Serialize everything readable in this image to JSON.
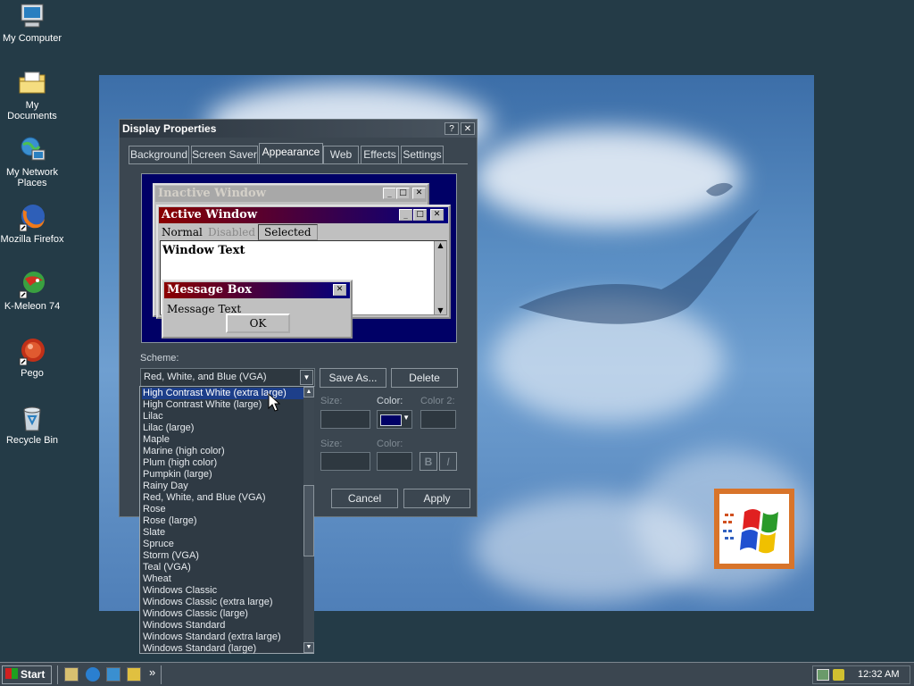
{
  "desktop": {
    "icons": [
      {
        "label": "My Computer",
        "icon": "computer-icon"
      },
      {
        "label": "My Documents",
        "icon": "folder-icon"
      },
      {
        "label": "My Network Places",
        "icon": "network-icon"
      },
      {
        "label": "Mozilla Firefox",
        "icon": "firefox-icon"
      },
      {
        "label": "K-Meleon 74",
        "icon": "kmeleon-icon"
      },
      {
        "label": "Pego",
        "icon": "pego-icon"
      },
      {
        "label": "Recycle Bin",
        "icon": "recycle-bin-icon"
      }
    ]
  },
  "window": {
    "title": "Display Properties",
    "help_glyph": "?",
    "close_glyph": "✕",
    "tabs": [
      "Background",
      "Screen Saver",
      "Appearance",
      "Web",
      "Effects",
      "Settings"
    ],
    "active_tab": "Appearance",
    "preview": {
      "inactive_title": "Inactive Window",
      "active_title": "Active Window",
      "menu": [
        "Normal",
        "Disabled",
        "Selected"
      ],
      "window_text": "Window Text",
      "msgbox_title": "Message Box",
      "msgbox_text": "Message Text",
      "ok_label": "OK"
    },
    "scheme_label": "Scheme:",
    "scheme_value": "Red, White, and Blue (VGA)",
    "save_as_label": "Save As...",
    "delete_label": "Delete",
    "size_label": "Size:",
    "color_label": "Color:",
    "color2_label": "Color 2:",
    "size_label_2": "Size:",
    "color_label_2": "Color:",
    "bold_label": "B",
    "italic_label": "I",
    "cancel_label": "Cancel",
    "apply_label": "Apply"
  },
  "dropdown": {
    "selected": "High Contrast White (extra large)",
    "options": [
      "High Contrast White (extra large)",
      "High Contrast White (large)",
      "Lilac",
      "Lilac (large)",
      "Maple",
      "Marine (high color)",
      "Plum (high color)",
      "Pumpkin (large)",
      "Rainy Day",
      "Red, White, and Blue (VGA)",
      "Rose",
      "Rose (large)",
      "Slate",
      "Spruce",
      "Storm (VGA)",
      "Teal (VGA)",
      "Wheat",
      "Windows Classic",
      "Windows Classic (extra large)",
      "Windows Classic (large)",
      "Windows Standard",
      "Windows Standard (extra large)",
      "Windows Standard (large)"
    ]
  },
  "taskbar": {
    "start_label": "Start",
    "quicklaunch_more": "»",
    "clock": "12:32 AM"
  },
  "colors": {
    "active_title_start": "#8b0000",
    "active_title_end": "#000080",
    "selection": "#1d3f8a",
    "desktop": "#243b47"
  }
}
